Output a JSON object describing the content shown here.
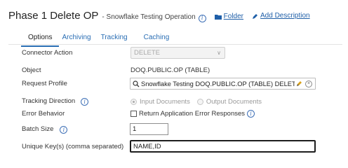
{
  "header": {
    "title": "Phase 1 Delete OP",
    "subtitle": "- Snowflake Testing Operation",
    "folder_link": "Folder",
    "add_description_link": "Add Description"
  },
  "tabs": [
    {
      "label": "Options",
      "active": true
    },
    {
      "label": "Archiving",
      "active": false
    },
    {
      "label": "Tracking",
      "active": false
    },
    {
      "label": "Caching",
      "active": false
    }
  ],
  "form": {
    "connector_action": {
      "label": "Connector Action",
      "value": "DELETE"
    },
    "object": {
      "label": "Object",
      "value": "DOQ.PUBLIC.OP (TABLE)"
    },
    "request_profile": {
      "label": "Request Profile",
      "value": "Snowflake Testing DOQ.PUBLIC.OP (TABLE) DELETE Requ"
    },
    "tracking_direction": {
      "label": "Tracking Direction",
      "options": [
        "Input Documents",
        "Output Documents"
      ],
      "selected": "Input Documents"
    },
    "error_behavior": {
      "label": "Error Behavior",
      "checkbox_label": "Return Application Error Responses",
      "checked": false
    },
    "batch_size": {
      "label": "Batch Size",
      "value": "1"
    },
    "unique_keys": {
      "label": "Unique Key(s) (comma separated)",
      "value": "NAME,ID"
    }
  },
  "colors": {
    "link": "#1f5fa8",
    "tab_active_underline": "#2a6eb4",
    "info_icon": "#3d6fb6"
  }
}
